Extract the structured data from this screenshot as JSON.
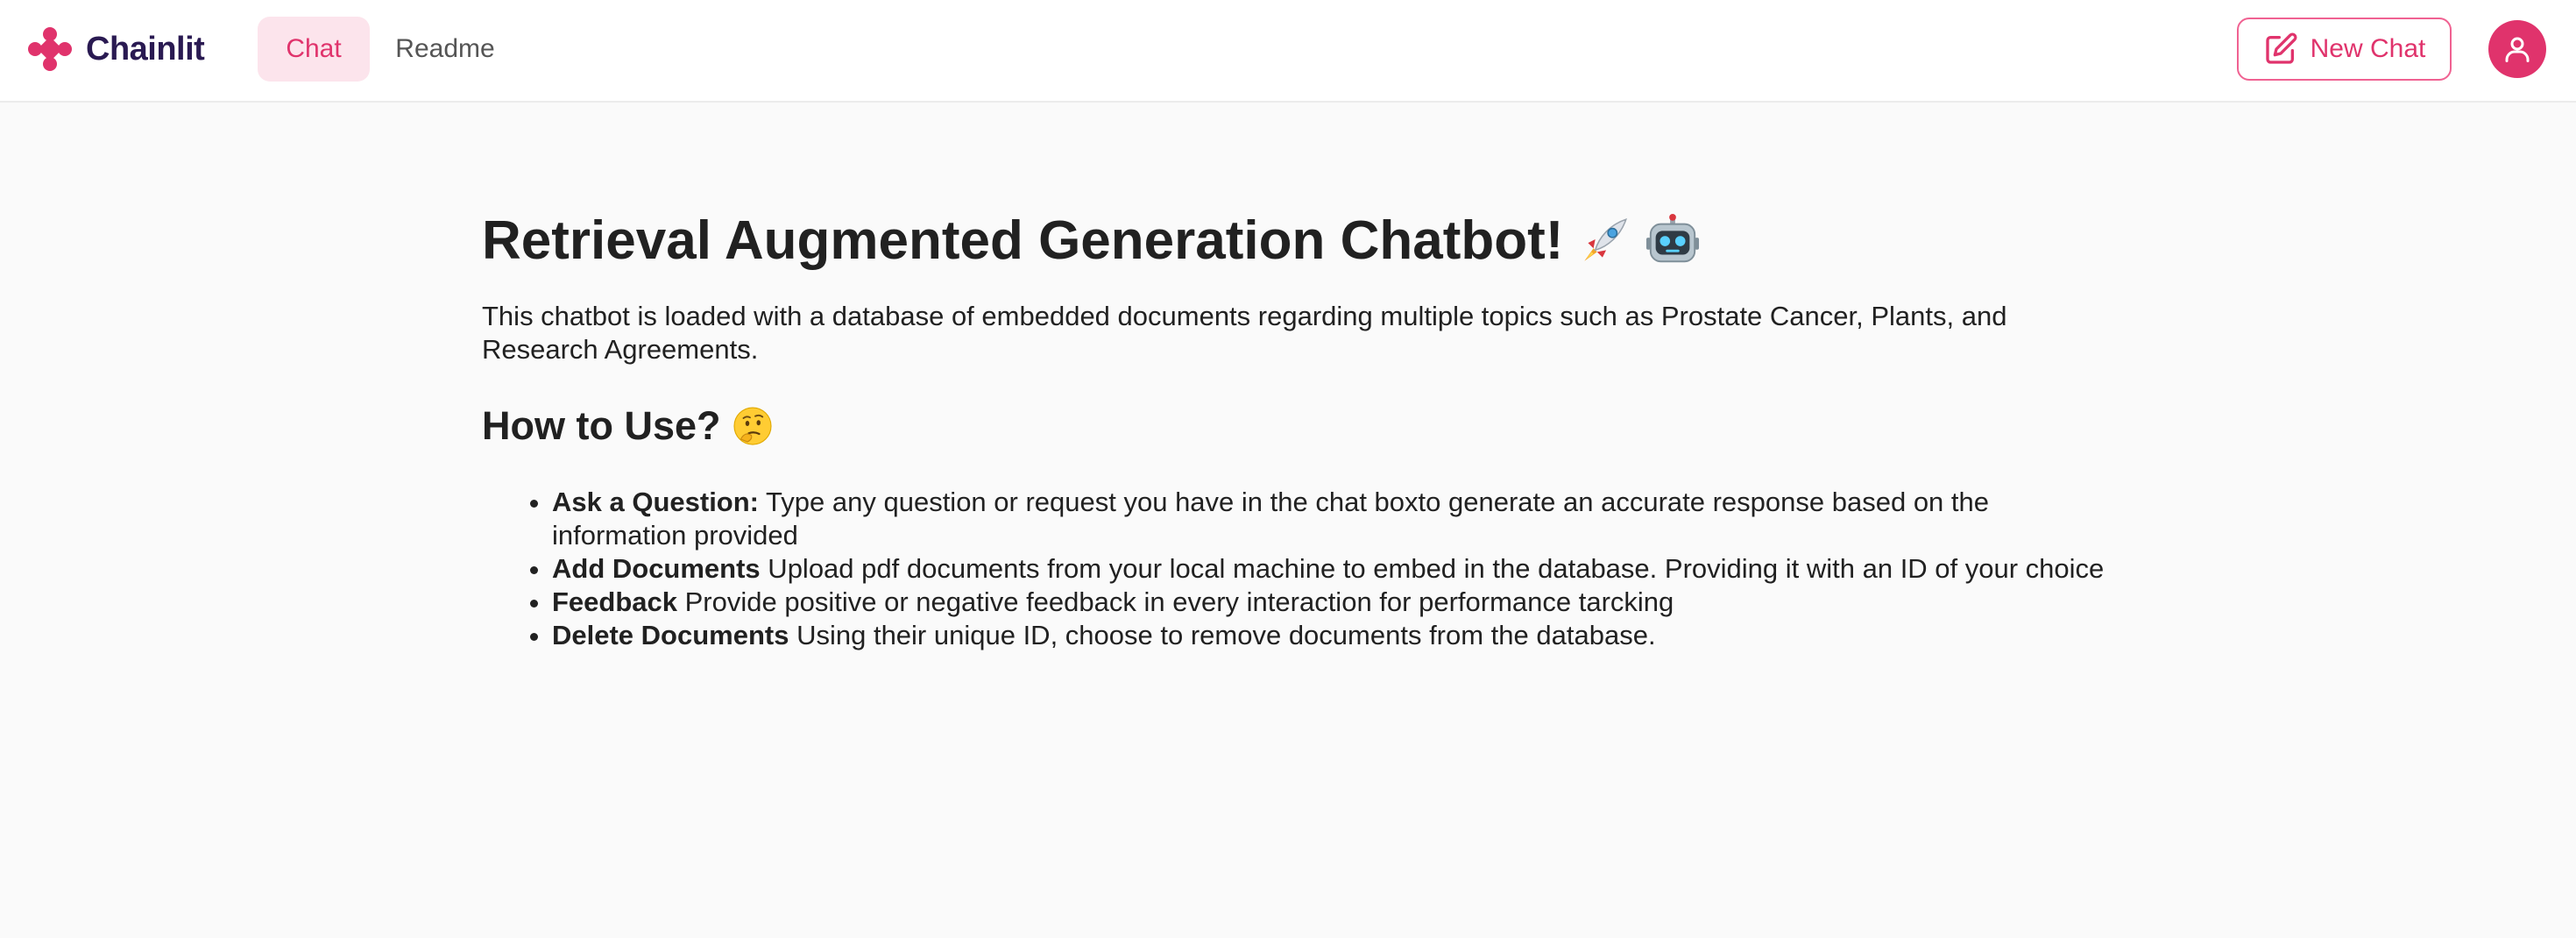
{
  "header": {
    "logo_text": "Chainlit",
    "tabs": [
      {
        "label": "Chat",
        "active": true
      },
      {
        "label": "Readme",
        "active": false
      }
    ],
    "new_chat_label": "New Chat",
    "accent_color": "#e0336c"
  },
  "main": {
    "title": "Retrieval Augmented Generation Chatbot!",
    "title_emojis": [
      "rocket-icon",
      "robot-icon"
    ],
    "intro": "This chatbot is loaded with a database of embedded documents regarding multiple topics such as Prostate Cancer, Plants, and Research Agreements.",
    "how_to_heading": "How to Use?",
    "how_to_emoji": "thinking-face-icon",
    "items": [
      {
        "term": "Ask a Question:",
        "text": " Type any question or request you have in the chat boxto generate an accurate response based on the information provided"
      },
      {
        "term": "Add Documents",
        "text": " Upload pdf documents from your local machine to embed in the database. Providing it with an ID of your choice"
      },
      {
        "term": "Feedback",
        "text": " Provide positive or negative feedback in every interaction for performance tarcking"
      },
      {
        "term": "Delete Documents",
        "text": " Using their unique ID, choose to remove documents from the database."
      }
    ]
  }
}
